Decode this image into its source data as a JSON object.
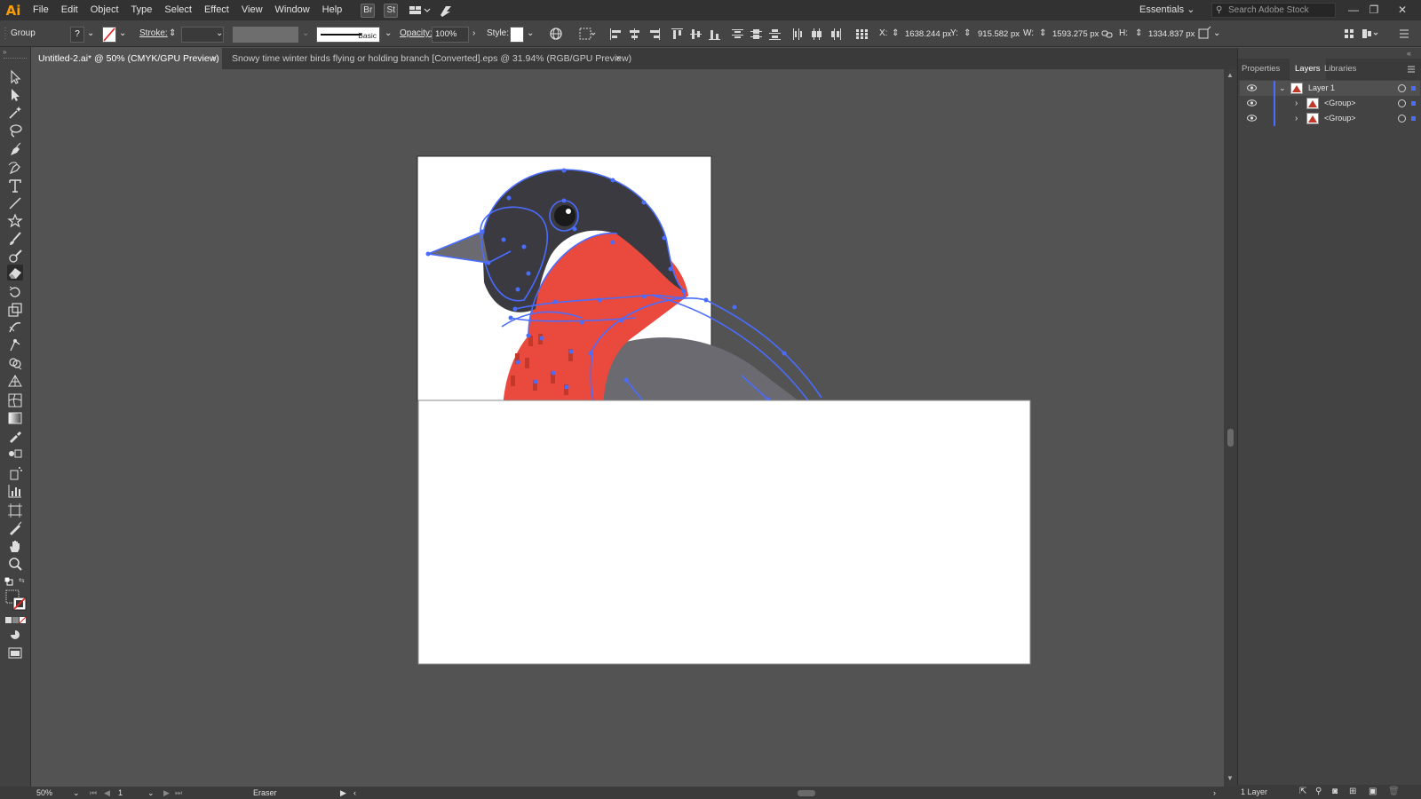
{
  "app": {
    "logo": "Ai"
  },
  "menu": [
    "File",
    "Edit",
    "Object",
    "Type",
    "Select",
    "Effect",
    "View",
    "Window",
    "Help"
  ],
  "menu_icons": {
    "br": "Br",
    "st": "St"
  },
  "workspace": "Essentials",
  "stock_search_placeholder": "Search Adobe Stock",
  "control": {
    "selection_type": "Group",
    "fill_value": "?",
    "stroke_label": "Stroke:",
    "brush_label": "Basic",
    "opacity_label": "Opacity:",
    "opacity_value": "100%",
    "style_label": "Style:",
    "x_label": "X:",
    "x_value": "1638.244 px",
    "y_label": "Y:",
    "y_value": "915.582 px",
    "w_label": "W:",
    "w_value": "1593.275 px",
    "h_label": "H:",
    "h_value": "1334.837 px"
  },
  "tabs": [
    {
      "label": "Untitled-2.ai* @ 50% (CMYK/GPU Preview)",
      "active": true
    },
    {
      "label": "Snowy time winter birds flying or holding branch [Converted].eps @ 31.94% (RGB/GPU Preview)",
      "active": false
    }
  ],
  "tab_close": "×",
  "panel": {
    "tabs": [
      "Properties",
      "Layers",
      "Libraries"
    ],
    "active_tab": "Layers",
    "layers": [
      {
        "name": "Layer 1",
        "level": 0,
        "expanded": true
      },
      {
        "name": "<Group>",
        "level": 1,
        "expanded": false
      },
      {
        "name": "<Group>",
        "level": 1,
        "expanded": false
      }
    ],
    "layer_count": "1 Layer"
  },
  "status": {
    "zoom": "50%",
    "artboard": "1",
    "tool": "Eraser"
  },
  "colors": {
    "bird_head": "#3a3a40",
    "bird_breast": "#ea4a3d",
    "bird_wing": "#6a6a70",
    "path_outline": "#4a6cff",
    "accent_logo": "#ff9a00"
  },
  "icons": {
    "tools": [
      "selection-icon",
      "direct-selection-icon",
      "magic-wand-icon",
      "lasso-icon",
      "pen-icon",
      "curvature-icon",
      "type-icon",
      "line-segment-icon",
      "star-icon",
      "paintbrush-icon",
      "blob-brush-icon",
      "eraser-icon",
      "rotate-icon",
      "scale-icon",
      "warp-icon",
      "puppet-warp-icon",
      "shape-builder-icon",
      "perspective-grid-icon",
      "mesh-icon",
      "gradient-icon",
      "eyedropper-icon",
      "blend-icon",
      "symbol-sprayer-icon",
      "column-graph-icon",
      "artboard-icon",
      "slice-icon",
      "hand-icon",
      "zoom-icon"
    ]
  }
}
